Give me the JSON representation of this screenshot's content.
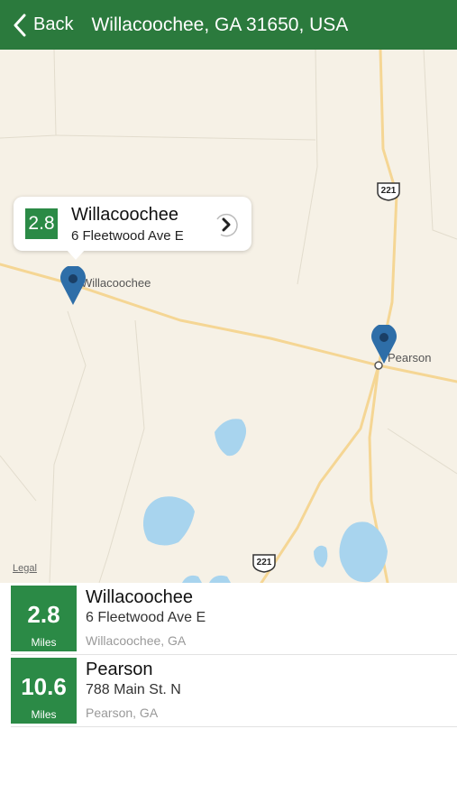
{
  "nav": {
    "back_label": "Back",
    "title": "Willacoochee, GA 31650, USA"
  },
  "map": {
    "towns": [
      "Willacoochee",
      "Pearson"
    ],
    "route_shields": [
      "221",
      "221"
    ],
    "legal": "Legal",
    "callout": {
      "distance": "2.8",
      "title": "Willacoochee",
      "address": "6 Fleetwood Ave E"
    }
  },
  "locations": [
    {
      "distance": "2.8",
      "unit": "Miles",
      "name": "Willacoochee",
      "address": "6 Fleetwood Ave E",
      "city": "Willacoochee, GA"
    },
    {
      "distance": "10.6",
      "unit": "Miles",
      "name": "Pearson",
      "address": "788 Main St. N",
      "city": "Pearson, GA"
    }
  ],
  "colors": {
    "nav_bar": "#2b7a3d",
    "badge": "#2b8a46",
    "map_land": "#f6f1e6",
    "water": "#a8d4ee",
    "road": "#f5d694",
    "pin": "#2e6ea8"
  }
}
